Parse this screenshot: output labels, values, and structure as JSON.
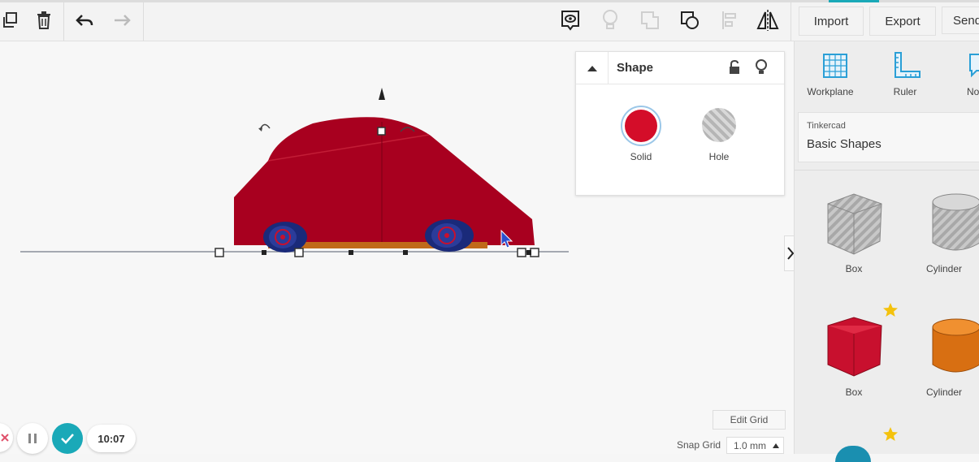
{
  "toolbar": {
    "copy_icon": "copy-icon",
    "delete_icon": "trash-icon",
    "undo_icon": "undo-icon",
    "redo_icon": "redo-icon",
    "import_label": "Import",
    "export_label": "Export",
    "send_label": "Send"
  },
  "shape_panel": {
    "title": "Shape",
    "solid_label": "Solid",
    "hole_label": "Hole",
    "solid_color": "#d40d29"
  },
  "right_panel": {
    "tools": [
      {
        "label": "Workplane"
      },
      {
        "label": "Ruler"
      },
      {
        "label": "No"
      }
    ],
    "library_source": "Tinkercad",
    "library_name": "Basic Shapes",
    "shapes": [
      {
        "label": "Box",
        "color": "#b0b0b0"
      },
      {
        "label": "Cylinder",
        "color": "#b0b0b0"
      },
      {
        "label": "Box",
        "color": "#c8102e"
      },
      {
        "label": "Cylinder",
        "color": "#e07a1a"
      }
    ]
  },
  "bottom": {
    "edit_grid_label": "Edit Grid",
    "snap_grid_label": "Snap Grid",
    "snap_grid_value": "1.0 mm",
    "timer": "10:07"
  },
  "colors": {
    "accent": "#1aa9b8",
    "car_body": "#a8001f"
  }
}
